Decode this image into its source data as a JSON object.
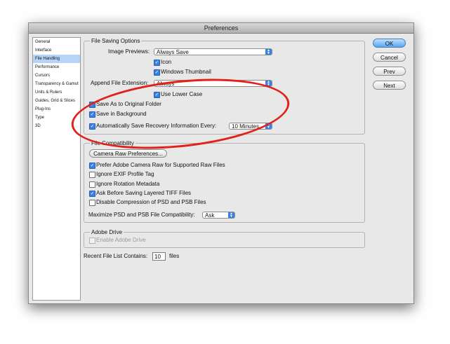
{
  "window": {
    "title": "Preferences"
  },
  "sidebar": {
    "items": [
      {
        "label": "General"
      },
      {
        "label": "Interface"
      },
      {
        "label": "File Handling"
      },
      {
        "label": "Performance"
      },
      {
        "label": "Cursors"
      },
      {
        "label": "Transparency & Gamut"
      },
      {
        "label": "Units & Rulers"
      },
      {
        "label": "Guides, Grid & Slices"
      },
      {
        "label": "Plug-Ins"
      },
      {
        "label": "Type"
      },
      {
        "label": "3D"
      }
    ],
    "selected": "File Handling"
  },
  "buttons": {
    "ok": "OK",
    "cancel": "Cancel",
    "prev": "Prev",
    "next": "Next"
  },
  "file_saving": {
    "title": "File Saving Options",
    "image_previews_label": "Image Previews:",
    "image_previews_value": "Always Save",
    "icon_label": "Icon",
    "icon_checked": true,
    "windows_thumbnail_label": "Windows Thumbnail",
    "windows_thumbnail_checked": true,
    "append_ext_label": "Append File Extension:",
    "append_ext_value": "Always",
    "lower_case_label": "Use Lower Case",
    "lower_case_checked": true,
    "save_original_label": "Save As to Original Folder",
    "save_original_checked": true,
    "save_background_label": "Save in Background",
    "save_background_checked": true,
    "auto_save_label": "Automatically Save Recovery Information Every:",
    "auto_save_checked": true,
    "auto_save_value": "10 Minutes"
  },
  "file_compat": {
    "title": "File Compatibility",
    "camera_raw_button": "Camera Raw Preferences...",
    "options": [
      {
        "label": "Prefer Adobe Camera Raw for Supported Raw Files",
        "checked": true
      },
      {
        "label": "Ignore EXIF Profile Tag",
        "checked": false
      },
      {
        "label": "Ignore Rotation Metadata",
        "checked": false
      },
      {
        "label": "Ask Before Saving Layered TIFF Files",
        "checked": true
      },
      {
        "label": "Disable Compression of PSD and PSB Files",
        "checked": false
      }
    ],
    "maximize_label": "Maximize PSD and PSB File Compatibility:",
    "maximize_value": "Ask"
  },
  "adobe_drive": {
    "title": "Adobe Drive",
    "enable_label": "Enable Adobe Drive",
    "enable_checked": false
  },
  "recent_files": {
    "label": "Recent File List Contains:",
    "value": "10",
    "suffix": "files"
  },
  "annotation": {
    "color": "#e0221b"
  },
  "colors": {
    "accent": "#3b7fe3",
    "selected_row": "#b6d4f7"
  },
  "icons": {
    "check": "checkmark-icon",
    "popup": "popup-arrows-icon"
  }
}
